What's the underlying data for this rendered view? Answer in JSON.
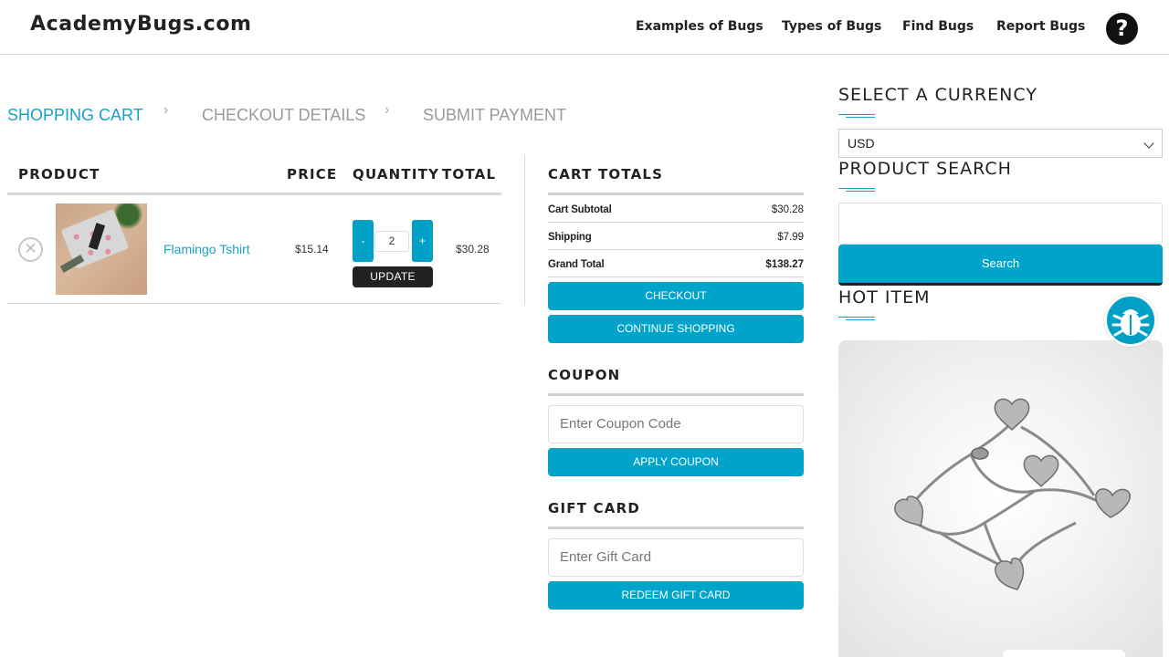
{
  "header": {
    "logo": "AcademyBugs.com",
    "nav": [
      "Examples of Bugs",
      "Types of Bugs",
      "Find Bugs",
      "Report Bugs"
    ],
    "help_icon": "question-circle-icon"
  },
  "breadcrumb": {
    "steps": [
      "SHOPPING CART",
      "CHECKOUT DETAILS",
      "SUBMIT PAYMENT"
    ],
    "active_index": 0,
    "separator": "›"
  },
  "cart": {
    "headers": {
      "product": "PRODUCT",
      "price": "PRICE",
      "quantity": "QUANTITY",
      "total": "TOTAL"
    },
    "items": [
      {
        "name": "Flamingo Tshirt",
        "price": "$15.14",
        "quantity": "2",
        "total": "$30.28"
      }
    ],
    "update_label": "UPDATE",
    "minus_label": "-",
    "plus_label": "+",
    "remove_icon": "remove-circle-icon"
  },
  "totals": {
    "title": "CART TOTALS",
    "rows": [
      {
        "label": "Cart Subtotal",
        "value": "$30.28"
      },
      {
        "label": "Shipping",
        "value": "$7.99"
      },
      {
        "label": "Grand Total",
        "value": "$138.27"
      }
    ],
    "checkout_label": "CHECKOUT",
    "continue_label": "CONTINUE SHOPPING"
  },
  "coupon": {
    "title": "COUPON",
    "placeholder": "Enter Coupon Code",
    "button_label": "APPLY COUPON"
  },
  "gift_card": {
    "title": "GIFT CARD",
    "placeholder": "Enter Gift Card",
    "button_label": "REDEEM GIFT CARD"
  },
  "sidebar": {
    "currency_title": "SELECT A CURRENCY",
    "currency_value": "USD",
    "search_title": "PRODUCT SEARCH",
    "search_button": "Search",
    "hot_item_title": "HOT ITEM",
    "bug_icon": "bug-icon"
  },
  "colors": {
    "accent": "#00a3ca",
    "link": "#1aa1c7",
    "dark": "#222222"
  }
}
